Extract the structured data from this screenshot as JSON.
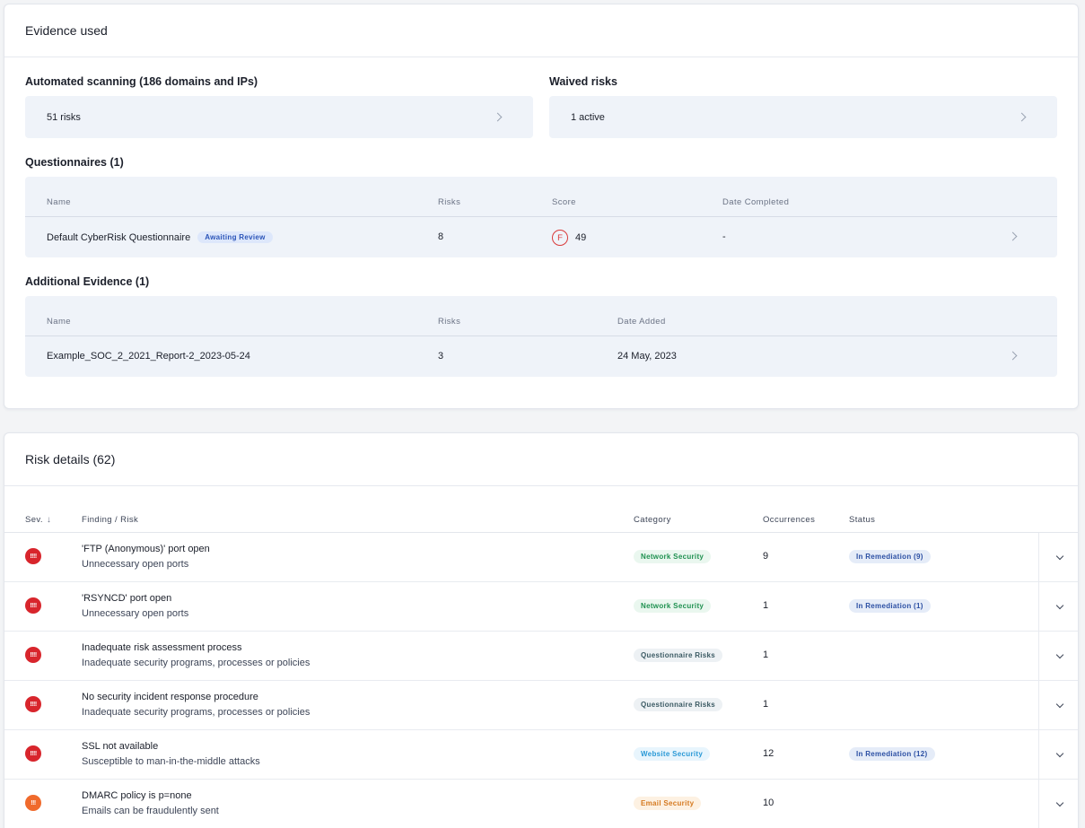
{
  "evidence": {
    "title": "Evidence used",
    "automated": {
      "heading": "Automated scanning (186 domains and IPs)",
      "value": "51 risks"
    },
    "waived": {
      "heading": "Waived risks",
      "value": "1 active"
    },
    "questionnaires": {
      "heading": "Questionnaires (1)",
      "columns": {
        "name": "Name",
        "risks": "Risks",
        "score": "Score",
        "date": "Date Completed"
      },
      "row": {
        "name": "Default CyberRisk Questionnaire",
        "badge": "Awaiting Review",
        "risks": "8",
        "grade": "F",
        "score": "49",
        "date": "-"
      }
    },
    "additional": {
      "heading": "Additional Evidence (1)",
      "columns": {
        "name": "Name",
        "risks": "Risks",
        "date": "Date Added"
      },
      "row": {
        "name": "Example_SOC_2_2021_Report-2_2023-05-24",
        "risks": "3",
        "date": "24 May, 2023"
      }
    }
  },
  "risks": {
    "title": "Risk details (62)",
    "columns": {
      "sev": "Sev.",
      "finding": "Finding / Risk",
      "category": "Category",
      "occurrences": "Occurrences",
      "status": "Status"
    },
    "rows": [
      {
        "severity": "critical",
        "sev_glyph": "!!!!",
        "title": "'FTP (Anonymous)' port open",
        "subtitle": "Unnecessary open ports",
        "category": "Network Security",
        "occurrences": "9",
        "status": "In Remediation (9)"
      },
      {
        "severity": "critical",
        "sev_glyph": "!!!!",
        "title": "'RSYNCD' port open",
        "subtitle": "Unnecessary open ports",
        "category": "Network Security",
        "occurrences": "1",
        "status": "In Remediation (1)"
      },
      {
        "severity": "critical",
        "sev_glyph": "!!!!",
        "title": "Inadequate risk assessment process",
        "subtitle": "Inadequate security programs, processes or policies",
        "category": "Questionnaire Risks",
        "occurrences": "1",
        "status": ""
      },
      {
        "severity": "critical",
        "sev_glyph": "!!!!",
        "title": "No security incident response procedure",
        "subtitle": "Inadequate security programs, processes or policies",
        "category": "Questionnaire Risks",
        "occurrences": "1",
        "status": ""
      },
      {
        "severity": "critical",
        "sev_glyph": "!!!!",
        "title": "SSL not available",
        "subtitle": "Susceptible to man-in-the-middle attacks",
        "category": "Website Security",
        "occurrences": "12",
        "status": "In Remediation (12)"
      },
      {
        "severity": "high",
        "sev_glyph": "!!!",
        "title": "DMARC policy is p=none",
        "subtitle": "Emails can be fraudulently sent",
        "category": "Email Security",
        "occurrences": "10",
        "status": ""
      }
    ]
  }
}
